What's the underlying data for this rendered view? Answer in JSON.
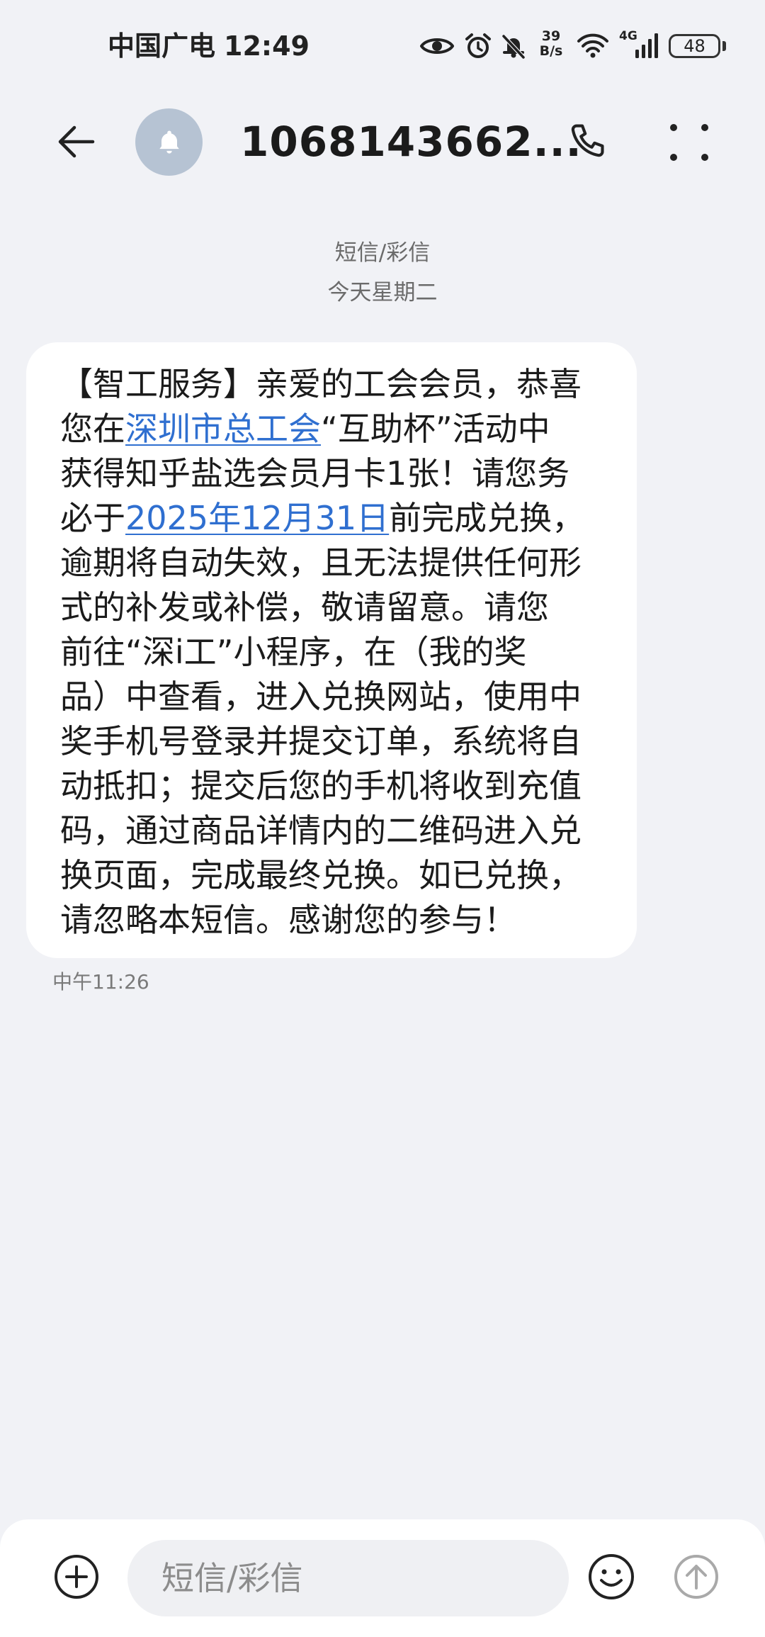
{
  "status_bar": {
    "carrier": "中国广电",
    "time": "12:49",
    "net_speed_value": "39",
    "net_speed_unit": "B/s",
    "network_type": "4G",
    "battery_level": "48",
    "icons": [
      "eye-comfort-icon",
      "alarm-icon",
      "bell-off-icon",
      "wifi-icon",
      "signal-icon",
      "battery-icon"
    ]
  },
  "header": {
    "title": "1068143662...",
    "icons": {
      "back": "back-arrow-icon",
      "avatar": "bell-icon",
      "call": "phone-icon",
      "more": "more-icon"
    }
  },
  "conversation": {
    "channel_label": "短信/彩信",
    "date_label": "今天星期二"
  },
  "message": {
    "lines": [
      [
        {
          "text": "【智工服务】亲爱的工会会员，恭喜"
        }
      ],
      [
        {
          "text": "您在"
        },
        {
          "text": "深圳市总工会",
          "link": true
        },
        {
          "text": "“互助杯”活动中"
        }
      ],
      [
        {
          "text": "获得知乎盐选会员月卡1张！请您务"
        }
      ],
      [
        {
          "text": "必于"
        },
        {
          "text": "2025年12月31日",
          "link": true
        },
        {
          "text": "前完成兑换，"
        }
      ],
      [
        {
          "text": "逾期将自动失效，且无法提供任何形"
        }
      ],
      [
        {
          "text": "式的补发或补偿，敬请留意。请您"
        }
      ],
      [
        {
          "text": "前往“深i工”小程序，在（我的奖"
        }
      ],
      [
        {
          "text": "品）中查看，进入兑换网站，使用中"
        }
      ],
      [
        {
          "text": "奖手机号登录并提交订单，系统将自"
        }
      ],
      [
        {
          "text": "动抵扣；提交后您的手机将收到充值"
        }
      ],
      [
        {
          "text": "码，通过商品详情内的二维码进入兑"
        }
      ],
      [
        {
          "text": "换页面，完成最终兑换。如已兑换，"
        }
      ],
      [
        {
          "text": "请忽略本短信。感谢您的参与！"
        }
      ]
    ],
    "time": "中午11:26"
  },
  "composer": {
    "placeholder": "短信/彩信",
    "icons": {
      "attach": "plus-circle-icon",
      "emoji": "emoji-icon",
      "send": "send-icon"
    }
  },
  "colors": {
    "background": "#f1f2f6",
    "bubble": "#ffffff",
    "link": "#2f6fd0",
    "avatar": "#b6c3d3",
    "send_disabled": "#a9a9a9"
  }
}
